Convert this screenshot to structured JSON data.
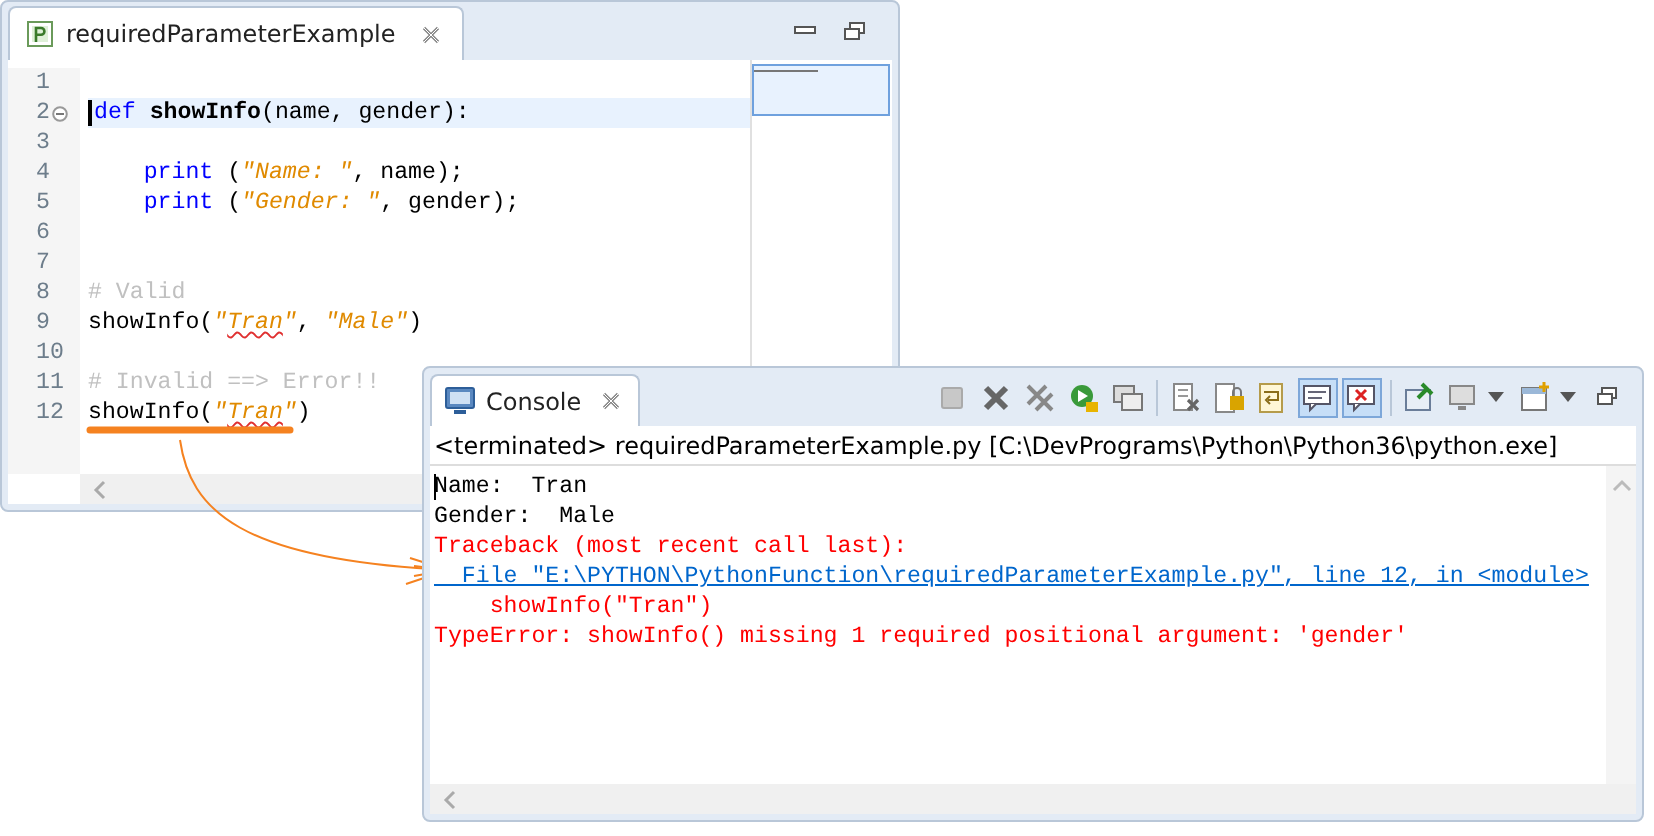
{
  "editor": {
    "tab_title": "requiredParameterExample",
    "lines": [
      {
        "number": "1",
        "current": false
      },
      {
        "number": "2",
        "current": true,
        "fold": true,
        "tokens": [
          {
            "text": "def ",
            "kind": "keyword"
          },
          {
            "text": "showInfo",
            "kind": "funcdef"
          },
          {
            "text": "(name, gender):",
            "kind": "plain"
          }
        ]
      },
      {
        "number": "3",
        "current": false
      },
      {
        "number": "4",
        "current": false,
        "indent": true,
        "tokens": [
          {
            "text": "print",
            "kind": "keyword"
          },
          {
            "text": " (",
            "kind": "plain"
          },
          {
            "text": "\"Name: \"",
            "kind": "string"
          },
          {
            "text": ", name);",
            "kind": "plain"
          }
        ]
      },
      {
        "number": "5",
        "current": false,
        "indent": true,
        "tokens": [
          {
            "text": "print",
            "kind": "keyword"
          },
          {
            "text": " (",
            "kind": "plain"
          },
          {
            "text": "\"Gender: \"",
            "kind": "string"
          },
          {
            "text": ", gender);",
            "kind": "plain"
          }
        ]
      },
      {
        "number": "6",
        "current": false
      },
      {
        "number": "7",
        "current": false
      },
      {
        "number": "8",
        "current": false,
        "tokens": [
          {
            "text": "# Valid",
            "kind": "comment"
          }
        ]
      },
      {
        "number": "9",
        "current": false,
        "tokens": [
          {
            "text": "showInfo(",
            "kind": "plain"
          },
          {
            "text": "\"",
            "kind": "string"
          },
          {
            "text": "Tran",
            "kind": "misspelled"
          },
          {
            "text": "\"",
            "kind": "string"
          },
          {
            "text": ", ",
            "kind": "plain"
          },
          {
            "text": "\"Male\"",
            "kind": "string"
          },
          {
            "text": ")",
            "kind": "plain"
          }
        ]
      },
      {
        "number": "10",
        "current": false
      },
      {
        "number": "11",
        "current": false,
        "tokens": [
          {
            "text": "# Invalid ==> Error!!",
            "kind": "comment"
          }
        ]
      },
      {
        "number": "12",
        "current": false,
        "tokens": [
          {
            "text": "showInfo(",
            "kind": "plain"
          },
          {
            "text": "\"",
            "kind": "string"
          },
          {
            "text": "Tran",
            "kind": "misspelled"
          },
          {
            "text": "\"",
            "kind": "string"
          },
          {
            "text": ")",
            "kind": "plain"
          }
        ]
      }
    ]
  },
  "console": {
    "tab_title": "Console",
    "toolbar": [
      {
        "kind": "terminate"
      },
      {
        "kind": "remove"
      },
      {
        "kind": "remove-all"
      },
      {
        "kind": "relaunch"
      },
      {
        "kind": "display"
      },
      {
        "kind": "separator"
      },
      {
        "kind": "clear"
      },
      {
        "kind": "scroll-lock",
        "pressed": false
      },
      {
        "kind": "word-wrap",
        "pressed": false
      },
      {
        "kind": "stdout",
        "pressed": true
      },
      {
        "kind": "stderr",
        "pressed": true
      },
      {
        "kind": "separator"
      },
      {
        "kind": "pin",
        "pressed": false
      },
      {
        "kind": "open-console"
      },
      {
        "kind": "new-console"
      },
      {
        "kind": "restore"
      }
    ],
    "status": "<terminated> requiredParameterExample.py [C:\\DevPrograms\\Python\\Python36\\python.exe]",
    "output": [
      {
        "text": "Name:  Tran",
        "kind": "stdout"
      },
      {
        "text": "Gender:  Male",
        "kind": "stdout"
      },
      {
        "text": "Traceback (most recent call last):",
        "kind": "stderr"
      },
      {
        "text": "  File \"E:\\PYTHON\\PythonFunction\\requiredParameterExample.py\", line 12, in <module>",
        "kind": "link"
      },
      {
        "text": "    showInfo(\"Tran\")",
        "kind": "stderr"
      },
      {
        "text": "TypeError: showInfo() missing 1 required positional argument: 'gender'",
        "kind": "stderr"
      }
    ]
  }
}
